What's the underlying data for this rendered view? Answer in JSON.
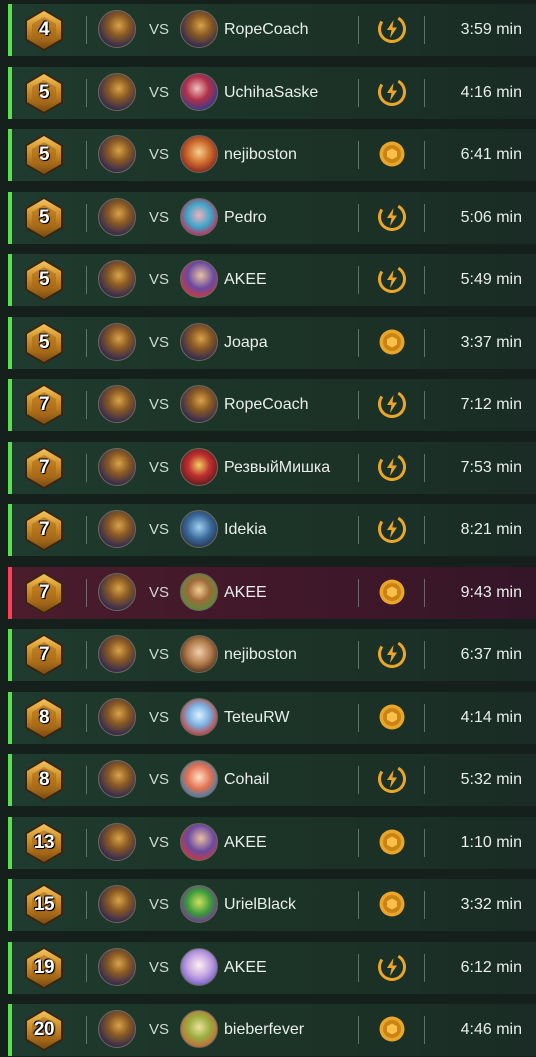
{
  "colors": {
    "win_accent": "#57e04a",
    "loss_accent": "#ff3d55",
    "badge_gold": "#d99a2b",
    "mode_icon": "#e9a62a"
  },
  "vs_label": "VS",
  "matches": [
    {
      "placement": "4",
      "opponent": "RopeCoach",
      "mode_icon": "lightning-icon",
      "duration": "3:59 min",
      "result": "win"
    },
    {
      "placement": "5",
      "opponent": "UchihaSaske",
      "mode_icon": "lightning-icon",
      "duration": "4:16 min",
      "result": "win"
    },
    {
      "placement": "5",
      "opponent": "nejiboston",
      "mode_icon": "coin-icon",
      "duration": "6:41 min",
      "result": "win"
    },
    {
      "placement": "5",
      "opponent": "Pedro",
      "mode_icon": "lightning-icon",
      "duration": "5:06 min",
      "result": "win"
    },
    {
      "placement": "5",
      "opponent": "AKEE",
      "mode_icon": "lightning-icon",
      "duration": "5:49 min",
      "result": "win"
    },
    {
      "placement": "5",
      "opponent": "Joapa",
      "mode_icon": "coin-icon",
      "duration": "3:37 min",
      "result": "win"
    },
    {
      "placement": "7",
      "opponent": "RopeCoach",
      "mode_icon": "lightning-icon",
      "duration": "7:12 min",
      "result": "win"
    },
    {
      "placement": "7",
      "opponent": "РезвыйМишка",
      "mode_icon": "lightning-icon",
      "duration": "7:53 min",
      "result": "win"
    },
    {
      "placement": "7",
      "opponent": "Idekia",
      "mode_icon": "lightning-icon",
      "duration": "8:21 min",
      "result": "win"
    },
    {
      "placement": "7",
      "opponent": "AKEE",
      "mode_icon": "coin-icon",
      "duration": "9:43 min",
      "result": "loss"
    },
    {
      "placement": "7",
      "opponent": "nejiboston",
      "mode_icon": "lightning-icon",
      "duration": "6:37 min",
      "result": "win"
    },
    {
      "placement": "8",
      "opponent": "TeteuRW",
      "mode_icon": "coin-icon",
      "duration": "4:14 min",
      "result": "win"
    },
    {
      "placement": "8",
      "opponent": "Cohail",
      "mode_icon": "lightning-icon",
      "duration": "5:32 min",
      "result": "win"
    },
    {
      "placement": "13",
      "opponent": "AKEE",
      "mode_icon": "coin-icon",
      "duration": "1:10 min",
      "result": "win"
    },
    {
      "placement": "15",
      "opponent": "UrielBlack",
      "mode_icon": "coin-icon",
      "duration": "3:32 min",
      "result": "win"
    },
    {
      "placement": "19",
      "opponent": "AKEE",
      "mode_icon": "lightning-icon",
      "duration": "6:12 min",
      "result": "win"
    },
    {
      "placement": "20",
      "opponent": "bieberfever",
      "mode_icon": "coin-icon",
      "duration": "4:46 min",
      "result": "win"
    }
  ]
}
